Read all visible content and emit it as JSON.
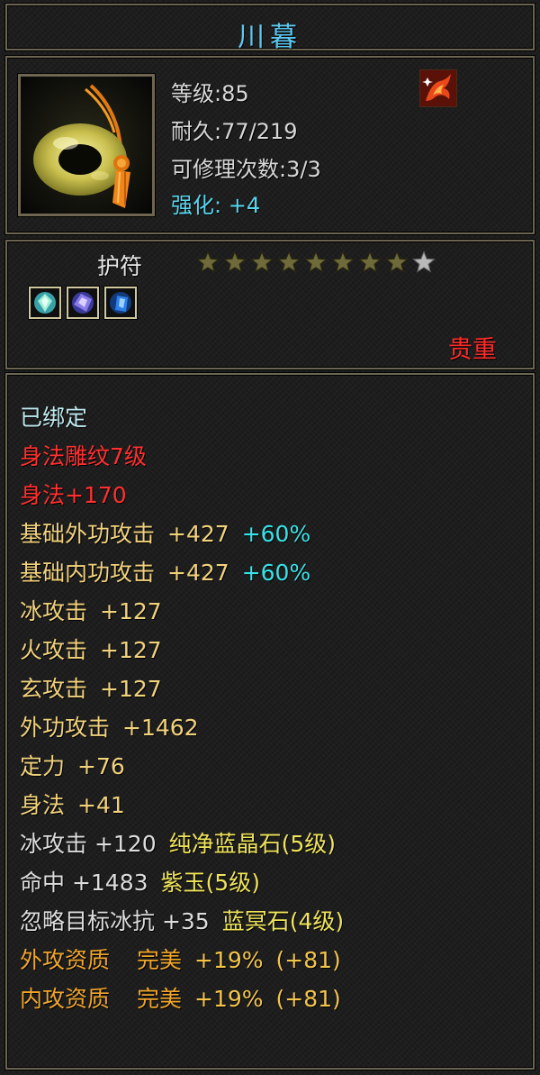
{
  "item": {
    "name": "川暮",
    "level": "等级:85",
    "durability": "耐久:77/219",
    "repair": "可修理次数:3/3",
    "enhance": "强化: +4",
    "icon": "jade-ring-amulet-icon",
    "badge_icon": "fire-phoenix-icon"
  },
  "type": {
    "label": "护符",
    "stars_total": 9,
    "stars_filled": 8,
    "gem_icons": [
      "green-crystal-gem-icon",
      "purple-crystal-gem-icon",
      "blue-crystal-gem-icon"
    ],
    "rarity": "贵重"
  },
  "stats": {
    "bound": "已绑定",
    "engraving": "身法雕纹7级",
    "engraving_bonus": "身法+170",
    "ext_attack_base": {
      "label": "基础外功攻击",
      "value": "+427",
      "pct": "+60%"
    },
    "int_attack_base": {
      "label": "基础内功攻击",
      "value": "+427",
      "pct": "+60%"
    },
    "ice_attack": {
      "label": "冰攻击",
      "value": "+127"
    },
    "fire_attack": {
      "label": "火攻击",
      "value": "+127"
    },
    "mystic_attack": {
      "label": "玄攻击",
      "value": "+127"
    },
    "ext_attack": {
      "label": "外功攻击",
      "value": "+1462"
    },
    "focus": {
      "label": "定力",
      "value": "+76"
    },
    "agility": {
      "label": "身法",
      "value": "+41"
    },
    "gem1": {
      "stat": "冰攻击 +120",
      "gem": "纯净蓝晶石(5级)"
    },
    "gem2": {
      "stat": "命中 +1483",
      "gem": "紫玉(5级)"
    },
    "gem3": {
      "stat": "忽略目标冰抗 +35",
      "gem": "蓝冥石(4级)"
    },
    "ext_aptitude": {
      "label": "外攻资质",
      "quality": "完美",
      "value": "+19%",
      "extra": "(+81)"
    },
    "int_aptitude": {
      "label": "内攻资质",
      "quality": "完美",
      "value": "+19%",
      "extra": "(+81)"
    }
  },
  "colors": {
    "title": "#5cc8f0",
    "enhance": "#56d6ee",
    "rarity": "#ff2a2a",
    "stat_gold": "#f1d27c",
    "percent_cyan": "#37e3e8",
    "gem_yellow": "#efe45a",
    "aptitude_orange": "#f0a62a",
    "border": "#6b6652"
  }
}
